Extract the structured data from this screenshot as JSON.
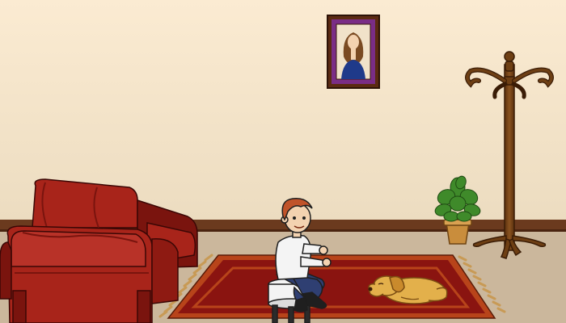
{
  "scene": {
    "name": "living-room",
    "objects": [
      "wall",
      "baseboard",
      "floor",
      "portrait",
      "coat-rack",
      "potted-plant",
      "armchair",
      "rug",
      "stool",
      "boy",
      "dog"
    ]
  },
  "colors": {
    "wall_top": "#fbebd2",
    "wall_bottom": "#ecdcc0",
    "baseboard": "#6b3a1e",
    "floor": "#cbb79c",
    "frame": "#5b2a12",
    "matte": "#7a2d86",
    "chair": "#a8241a",
    "chair_dark": "#7a140e",
    "rug_border": "#b8441a",
    "rug_field": "#8a1410",
    "rug_fringe": "#c89a55",
    "wood": "#6e3f14",
    "plant": "#3f8a2a",
    "pot": "#c98d3c",
    "dog": "#e3b04b",
    "boy_hair": "#c0532a",
    "boy_shirt": "#f4f4f4",
    "boy_jeans": "#2f3f72"
  }
}
